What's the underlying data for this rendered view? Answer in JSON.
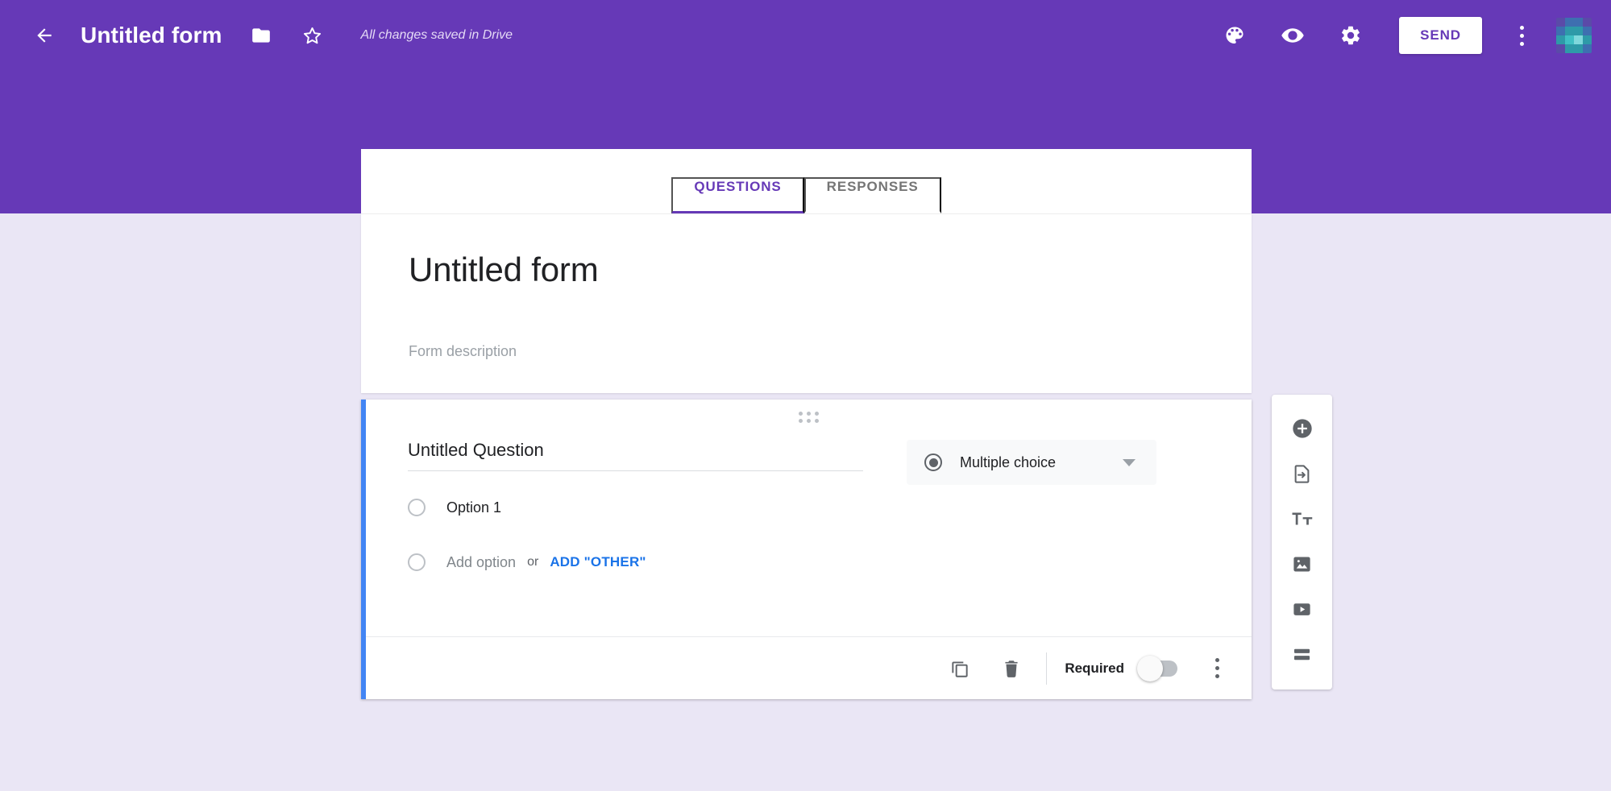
{
  "theme": {
    "header_purple": "#6639B7",
    "page_background": "#EAE6F5",
    "accent_blue": "#4285F4",
    "link_blue": "#1A73E8",
    "text_primary": "#202124",
    "text_secondary": "#5F6368",
    "text_muted": "#9AA0A6"
  },
  "header": {
    "back_icon": "back-arrow-icon",
    "title": "Untitled form",
    "folder_icon": "folder-icon",
    "star_icon": "star-icon",
    "save_status": "All changes saved in Drive",
    "palette_icon": "palette-icon",
    "preview_icon": "eye-preview-icon",
    "settings_icon": "gear-settings-icon",
    "send_label": "SEND",
    "overflow_icon": "more-vert-icon",
    "avatar_label": "account-avatar"
  },
  "tabs": [
    {
      "label": "QUESTIONS",
      "active": true
    },
    {
      "label": "RESPONSES",
      "active": false
    }
  ],
  "form": {
    "title": "Untitled form",
    "description_placeholder": "Form description"
  },
  "question": {
    "drag_handle_icon": "drag-handle-icon",
    "title": "Untitled Question",
    "type": {
      "icon": "radio-filled-icon",
      "label": "Multiple choice",
      "chevron_icon": "chevron-down-icon"
    },
    "options": [
      {
        "label": "Option 1"
      }
    ],
    "add_option_label": "Add option",
    "or_label": "or",
    "add_other_label": "ADD \"OTHER\"",
    "footer": {
      "duplicate_icon": "duplicate-icon",
      "delete_icon": "trash-delete-icon",
      "required_label": "Required",
      "required_on": false,
      "overflow_icon": "more-vert-icon"
    }
  },
  "sidebar": {
    "items": [
      {
        "icon": "add-circle-icon",
        "name": "add-question-button"
      },
      {
        "icon": "import-questions-icon",
        "name": "import-questions-button"
      },
      {
        "icon": "title-text-icon",
        "name": "add-title-button"
      },
      {
        "icon": "image-icon",
        "name": "add-image-button"
      },
      {
        "icon": "video-icon",
        "name": "add-video-button"
      },
      {
        "icon": "section-icon",
        "name": "add-section-button"
      }
    ]
  },
  "avatar_pixels": [
    "#5B4AA8",
    "#3E6FB0",
    "#3E6FB0",
    "#5B4AA8",
    "#3E6FB0",
    "#2E9AA8",
    "#2E9AA8",
    "#3E6FB0",
    "#2E9AA8",
    "#3FC0C4",
    "#7FD8DC",
    "#2E9AA8",
    "#5B4AA8",
    "#2E9AA8",
    "#2E9AA8",
    "#3E6FB0"
  ]
}
